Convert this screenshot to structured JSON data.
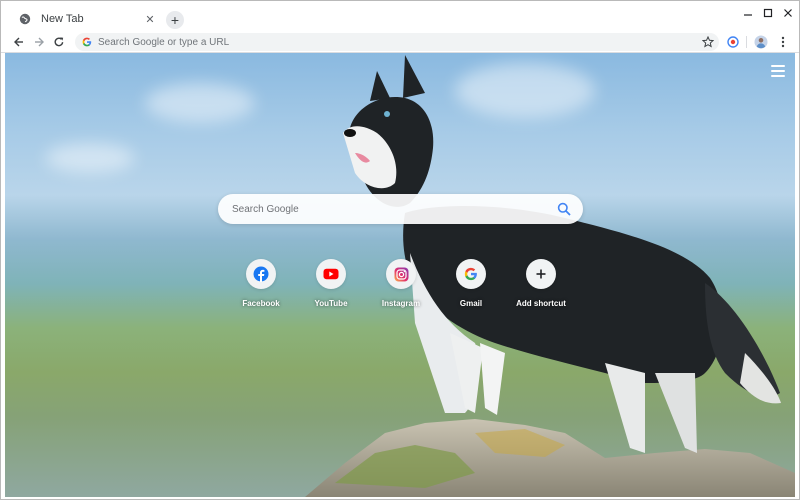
{
  "tab": {
    "title": "New Tab",
    "close_glyph": "✕",
    "favicon": "globe-icon"
  },
  "newtab": {
    "glyph": "+"
  },
  "window_controls": {
    "minimize": "minimize-icon",
    "maximize": "maximize-icon",
    "close": "close-icon"
  },
  "toolbar": {
    "back": "arrow-left-icon",
    "forward": "arrow-right-icon",
    "reload": "reload-icon",
    "omnibox_placeholder": "Search Google or type a URL",
    "bookmark": "star-icon",
    "extension": "record-icon",
    "profile": "avatar-icon",
    "menu": "kebab-menu-icon"
  },
  "search": {
    "placeholder": "Search Google"
  },
  "shortcuts": [
    {
      "label": "Facebook",
      "icon": "facebook-icon",
      "color": "#1877f2"
    },
    {
      "label": "YouTube",
      "icon": "youtube-icon",
      "color": "#ff0000"
    },
    {
      "label": "Instagram",
      "icon": "instagram-icon",
      "color": "#d6249f"
    },
    {
      "label": "Gmail",
      "icon": "google-icon",
      "color": "#4285f4"
    },
    {
      "label": "Add shortcut",
      "icon": "plus-icon",
      "color": "#202124"
    }
  ],
  "colors": {
    "google_blue": "#4285f4",
    "accent": "#1a73e8"
  }
}
